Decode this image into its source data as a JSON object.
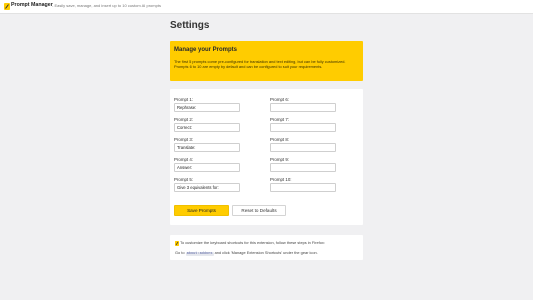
{
  "header": {
    "app_title": "Prompt Manager",
    "app_subtitle": "- Easily save, manage, and insert up to 10 custom AI prompts",
    "logo_icon": "pencil-logo-icon"
  },
  "page": {
    "title": "Settings"
  },
  "info": {
    "title": "Manage your Prompts",
    "text": "The first 5 prompts come pre-configured for translation and text editing, but can be fully customized. Prompts 6 to 10 are empty by default and can be configured to suit your requirements."
  },
  "prompts": [
    {
      "label": "Prompt 1:",
      "value": "Rephrase:"
    },
    {
      "label": "Prompt 2:",
      "value": "Correct:"
    },
    {
      "label": "Prompt 3:",
      "value": "Translate:"
    },
    {
      "label": "Prompt 4:",
      "value": "Answer:"
    },
    {
      "label": "Prompt 5:",
      "value": "Give 3 equivalents for:"
    },
    {
      "label": "Prompt 6:",
      "value": ""
    },
    {
      "label": "Prompt 7:",
      "value": ""
    },
    {
      "label": "Prompt 8:",
      "value": ""
    },
    {
      "label": "Prompt 9:",
      "value": ""
    },
    {
      "label": "Prompt 10:",
      "value": ""
    }
  ],
  "buttons": {
    "save_label": "Save Prompts",
    "reset_label": "Reset to Defaults"
  },
  "note": {
    "line1": "To customize the keyboard shortcuts for this extension, follow these steps in Firefox:",
    "line2_pre": "Go to",
    "line2_code": "about:addons",
    "line2_post": "and click 'Manage Extension Shortcuts' under the gear icon.",
    "icon": "pencil-note-icon"
  },
  "colors": {
    "accent": "#ffcc00",
    "background": "#f0f0f2"
  }
}
